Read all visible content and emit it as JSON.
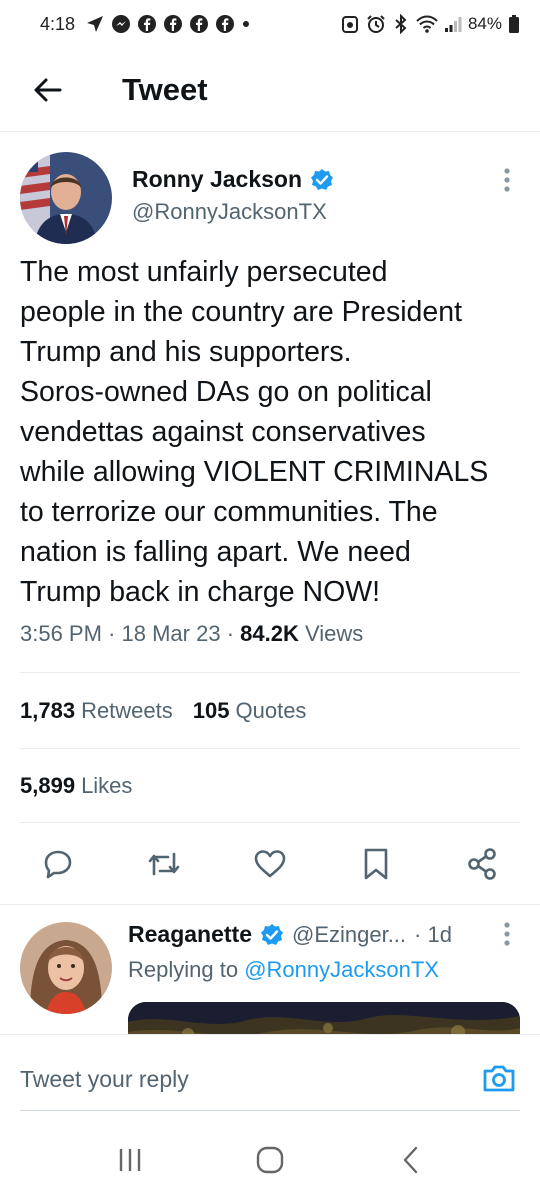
{
  "status_bar": {
    "time": "4:18",
    "battery": "84%",
    "left_icons": [
      "navigation-icon",
      "messenger-icon",
      "facebook-icon",
      "facebook-icon",
      "facebook-icon",
      "facebook-icon",
      "dot-icon"
    ],
    "right_icons": [
      "alarm-icon",
      "alarm-clock-icon",
      "bluetooth-icon",
      "wifi-icon",
      "signal-icon",
      "battery-icon"
    ]
  },
  "header": {
    "title": "Tweet",
    "back_icon": "back-arrow-icon"
  },
  "tweet": {
    "author_name": "Ronny Jackson",
    "author_handle": "@RonnyJacksonTX",
    "verified": true,
    "text": "The most unfairly persecuted\npeople in the country are President\nTrump and his supporters.\nSoros-owned DAs go on political\nvendettas against conservatives\nwhile allowing VIOLENT CRIMINALS\nto terrorize our communities. The\nnation is falling apart. We need\nTrump back in charge NOW!",
    "time": "3:56 PM",
    "date": "18 Mar 23",
    "views_count": "84.2K",
    "views_label": "Views",
    "separator": "·",
    "retweets_count": "1,783",
    "retweets_label": "Retweets",
    "quotes_count": "105",
    "quotes_label": "Quotes",
    "likes_count": "5,899",
    "likes_label": "Likes"
  },
  "actions": [
    "reply-icon",
    "retweet-icon",
    "like-icon",
    "bookmark-icon",
    "share-icon"
  ],
  "reply": {
    "author_name": "Reaganette",
    "author_handle": "@Ezinger...",
    "age": "· 1d",
    "verified": true,
    "replying_prefix": "Replying to",
    "replying_to": "@RonnyJacksonTX"
  },
  "compose": {
    "placeholder": "Tweet your reply"
  },
  "colors": {
    "accent": "#1d9bf0",
    "text_primary": "#0f1419",
    "text_secondary": "#536471"
  }
}
